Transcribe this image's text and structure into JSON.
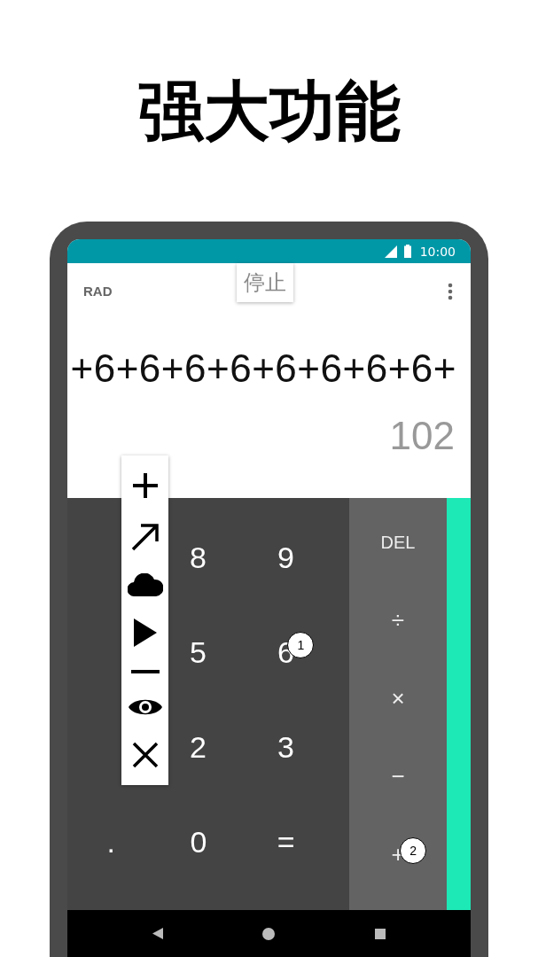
{
  "headline": "强大功能",
  "status_bar": {
    "time": "10:00"
  },
  "display": {
    "mode": "RAD",
    "stop_button": "停止",
    "expression": "+6+6+6+6+6+6+6+6+",
    "result": "102"
  },
  "digit_rows": [
    {
      "keys": [
        {
          "label": "8"
        },
        {
          "label": "9"
        }
      ]
    },
    {
      "keys": [
        {
          "label": "5"
        },
        {
          "label": "6",
          "badge": "1"
        }
      ]
    },
    {
      "keys": [
        {
          "label": "2"
        },
        {
          "label": "3"
        }
      ]
    },
    {
      "keys": [
        {
          "label": "."
        },
        {
          "label": "0"
        },
        {
          "label": "="
        }
      ]
    }
  ],
  "operator_keys": [
    {
      "label": "DEL"
    },
    {
      "label": "÷"
    },
    {
      "label": "×"
    },
    {
      "label": "−"
    },
    {
      "label": "+",
      "badge": "2"
    }
  ]
}
